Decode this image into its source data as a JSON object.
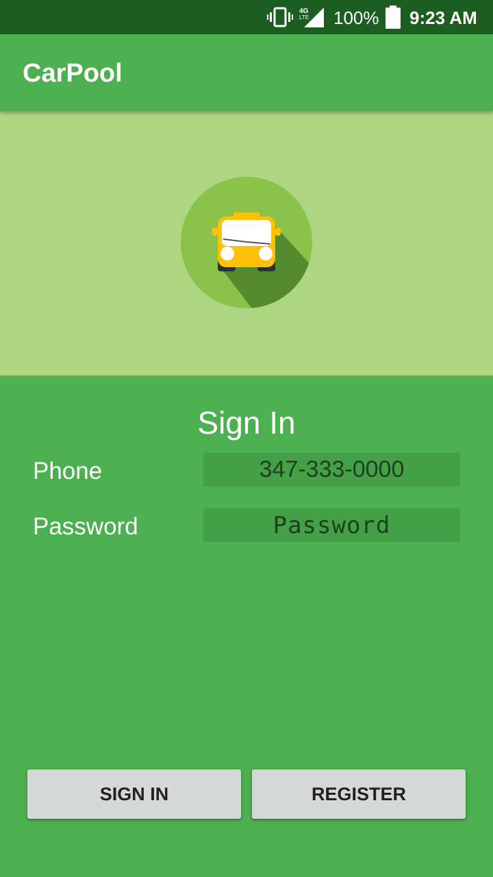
{
  "status_bar": {
    "network_type": "4G LTE",
    "battery_percent": "100%",
    "time": "9:23 AM",
    "icons": [
      "vibrate-icon",
      "signal-4g-lte-icon",
      "battery-full-icon"
    ]
  },
  "app_bar": {
    "title": "CarPool"
  },
  "hero": {
    "icon": "bus-logo-icon",
    "colors": {
      "background": "#aed581",
      "circle": "#8bc34a",
      "shadow": "#558b2f",
      "bus": "#ffc107"
    }
  },
  "form": {
    "title": "Sign In",
    "phone": {
      "label": "Phone",
      "placeholder": "347-333-0000",
      "value": ""
    },
    "password": {
      "label": "Password",
      "placeholder": "Password",
      "value": ""
    }
  },
  "buttons": {
    "sign_in": "SIGN IN",
    "register": "REGISTER"
  },
  "colors": {
    "primary": "#4caf50",
    "primary_dark": "#1b5e20",
    "accent_light": "#aed581",
    "input_bg": "#43a047"
  }
}
